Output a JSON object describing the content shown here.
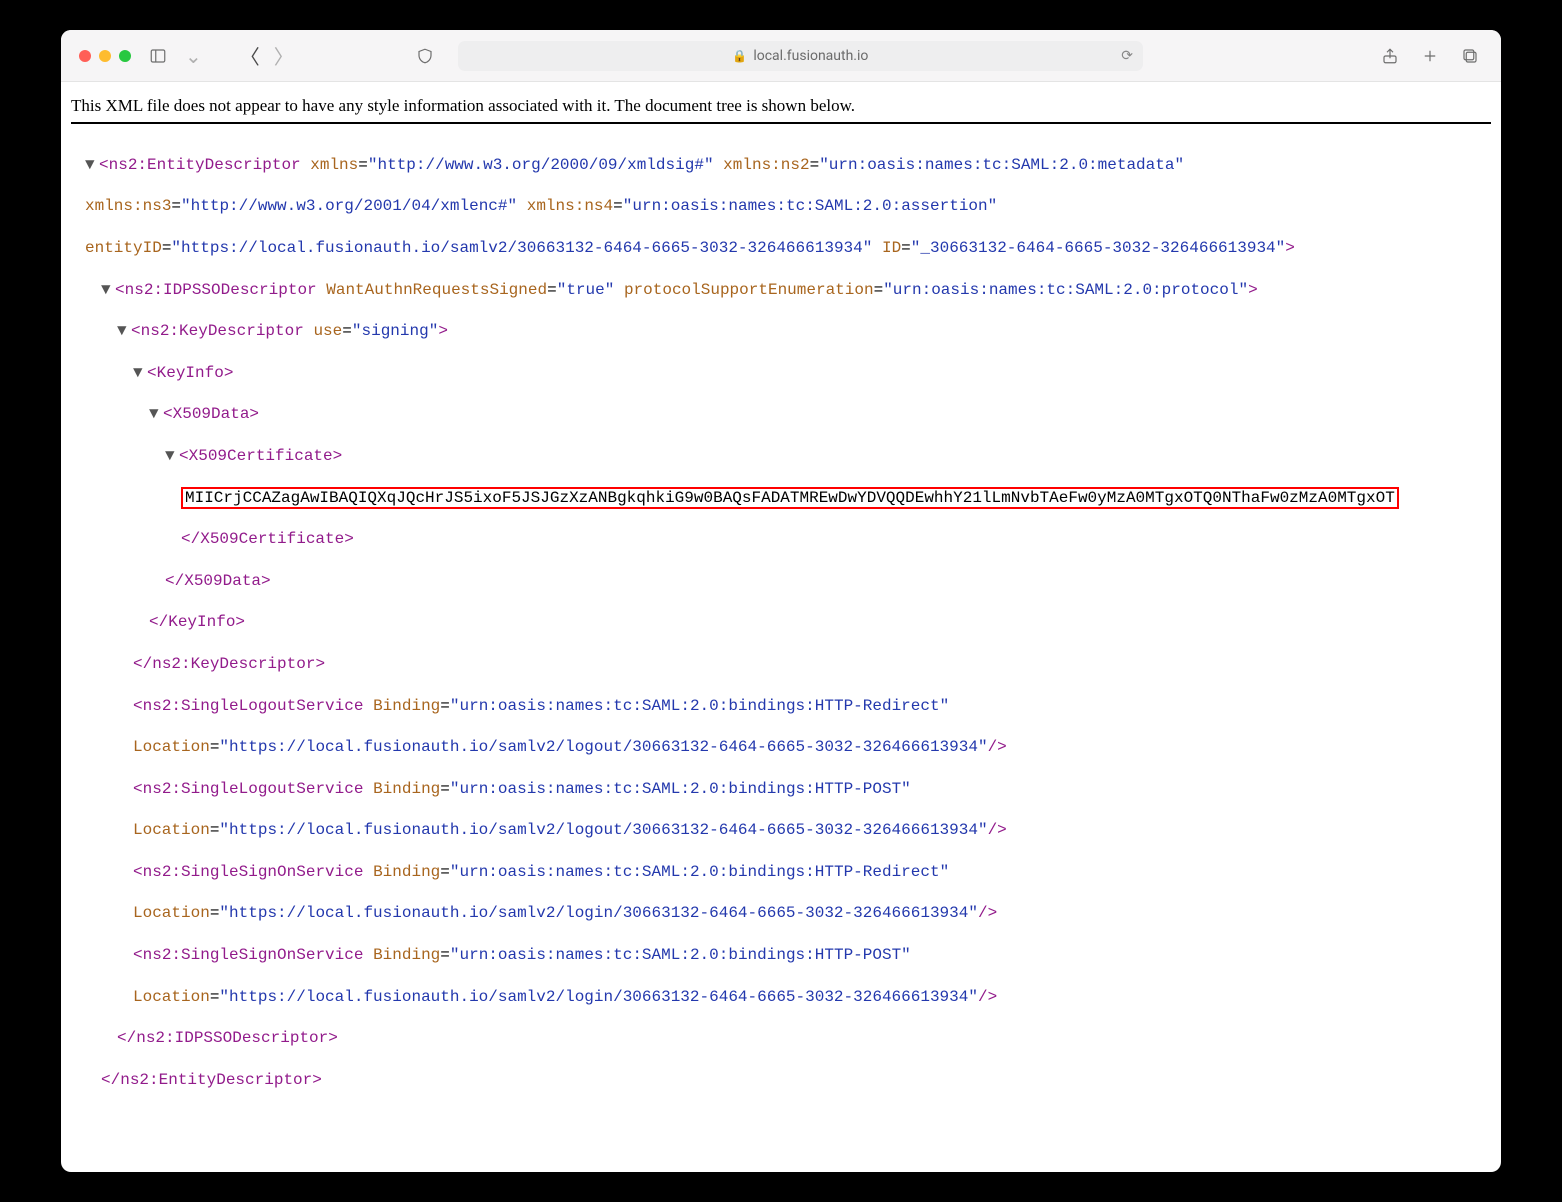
{
  "browser": {
    "url_display": "local.fusionauth.io"
  },
  "notice": "This XML file does not appear to have any style information associated with it. The document tree is shown below.",
  "xml": {
    "root_open": "ns2:EntityDescriptor",
    "root_close": "/ns2:EntityDescriptor",
    "root_attrs": {
      "xmlns_k": "xmlns",
      "xmlns_v": "http://www.w3.org/2000/09/xmldsig#",
      "ns2_k": "xmlns:ns2",
      "ns2_v": "urn:oasis:names:tc:SAML:2.0:metadata",
      "ns3_k": "xmlns:ns3",
      "ns3_v": "http://www.w3.org/2001/04/xmlenc#",
      "ns4_k": "xmlns:ns4",
      "ns4_v": "urn:oasis:names:tc:SAML:2.0:assertion",
      "entityID_k": "entityID",
      "entityID_v": "https://local.fusionauth.io/samlv2/30663132-6464-6665-3032-326466613934",
      "ID_k": "ID",
      "ID_v": "_30663132-6464-6665-3032-326466613934"
    },
    "idp_open": "ns2:IDPSSODescriptor",
    "idp_close": "/ns2:IDPSSODescriptor",
    "idp_attrs": {
      "want_k": "WantAuthnRequestsSigned",
      "want_v": "true",
      "proto_k": "protocolSupportEnumeration",
      "proto_v": "urn:oasis:names:tc:SAML:2.0:protocol"
    },
    "key_open": "ns2:KeyDescriptor",
    "key_close": "/ns2:KeyDescriptor",
    "key_attrs": {
      "use_k": "use",
      "use_v": "signing"
    },
    "keyinfo_open": "KeyInfo",
    "keyinfo_close": "/KeyInfo",
    "x509data_open": "X509Data",
    "x509data_close": "/X509Data",
    "x509cert_open": "X509Certificate",
    "x509cert_close": "/X509Certificate",
    "cert_value": "MIICrjCCAZagAwIBAQIQXqJQcHrJS5ixoF5JSJGzXzANBgkqhkiG9w0BAQsFADATMREwDwYDVQQDEwhhY21lLmNvbTAeFw0yMzA0MTgxOTQ0NThaFw0zMzA0MTgxOT",
    "slo1": {
      "tag": "ns2:SingleLogoutService",
      "bind_k": "Binding",
      "bind_v": "urn:oasis:names:tc:SAML:2.0:bindings:HTTP-Redirect",
      "loc_k": "Location",
      "loc_v": "https://local.fusionauth.io/samlv2/logout/30663132-6464-6665-3032-326466613934"
    },
    "slo2": {
      "tag": "ns2:SingleLogoutService",
      "bind_k": "Binding",
      "bind_v": "urn:oasis:names:tc:SAML:2.0:bindings:HTTP-POST",
      "loc_k": "Location",
      "loc_v": "https://local.fusionauth.io/samlv2/logout/30663132-6464-6665-3032-326466613934"
    },
    "sso1": {
      "tag": "ns2:SingleSignOnService",
      "bind_k": "Binding",
      "bind_v": "urn:oasis:names:tc:SAML:2.0:bindings:HTTP-Redirect",
      "loc_k": "Location",
      "loc_v": "https://local.fusionauth.io/samlv2/login/30663132-6464-6665-3032-326466613934"
    },
    "sso2": {
      "tag": "ns2:SingleSignOnService",
      "bind_k": "Binding",
      "bind_v": "urn:oasis:names:tc:SAML:2.0:bindings:HTTP-POST",
      "loc_k": "Location",
      "loc_v": "https://local.fusionauth.io/samlv2/login/30663132-6464-6665-3032-326466613934"
    }
  }
}
